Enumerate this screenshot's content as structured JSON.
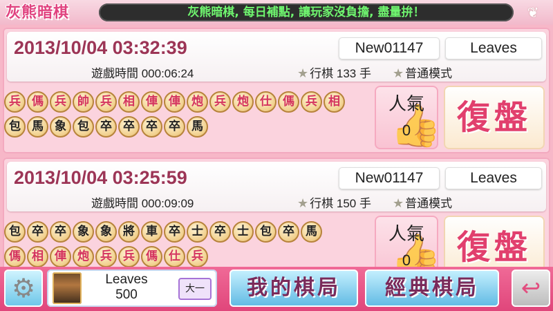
{
  "header": {
    "logo_text": "灰熊暗棋",
    "marquee_text": "灰熊暗棋, 每日補點, 讓玩家沒負擔, 盡量拚！",
    "wings_icon": "wings-icon"
  },
  "games": [
    {
      "datetime": "2013/10/04 03:32:39",
      "duration": "遊戲時間 000:06:24",
      "player1": "New01147",
      "player2": "Leaves",
      "moves": "行棋 133 手",
      "mode": "普通模式",
      "popularity_label": "人氣",
      "popularity_count": "0",
      "replay_label": "復盤",
      "pieces_row1": [
        {
          "t": "兵",
          "c": "red"
        },
        {
          "t": "傌",
          "c": "red"
        },
        {
          "t": "兵",
          "c": "red"
        },
        {
          "t": "帥",
          "c": "red"
        },
        {
          "t": "兵",
          "c": "red"
        },
        {
          "t": "相",
          "c": "red"
        },
        {
          "t": "俥",
          "c": "red"
        },
        {
          "t": "俥",
          "c": "red"
        },
        {
          "t": "炮",
          "c": "red"
        },
        {
          "t": "兵",
          "c": "red"
        },
        {
          "t": "炮",
          "c": "red"
        },
        {
          "t": "仕",
          "c": "red"
        },
        {
          "t": "傌",
          "c": "red"
        },
        {
          "t": "兵",
          "c": "red"
        },
        {
          "t": "相",
          "c": "red"
        }
      ],
      "pieces_row2": [
        {
          "t": "包",
          "c": "black"
        },
        {
          "t": "馬",
          "c": "black"
        },
        {
          "t": "象",
          "c": "black"
        },
        {
          "t": "包",
          "c": "black"
        },
        {
          "t": "卒",
          "c": "black"
        },
        {
          "t": "卒",
          "c": "black"
        },
        {
          "t": "卒",
          "c": "black"
        },
        {
          "t": "卒",
          "c": "black"
        },
        {
          "t": "馬",
          "c": "black"
        }
      ]
    },
    {
      "datetime": "2013/10/04 03:25:59",
      "duration": "遊戲時間 000:09:09",
      "player1": "New01147",
      "player2": "Leaves",
      "moves": "行棋 150 手",
      "mode": "普通模式",
      "popularity_label": "人氣",
      "popularity_count": "0",
      "replay_label": "復盤",
      "pieces_row1": [
        {
          "t": "包",
          "c": "black"
        },
        {
          "t": "卒",
          "c": "black"
        },
        {
          "t": "卒",
          "c": "black"
        },
        {
          "t": "象",
          "c": "black"
        },
        {
          "t": "象",
          "c": "black"
        },
        {
          "t": "將",
          "c": "black"
        },
        {
          "t": "車",
          "c": "black"
        },
        {
          "t": "卒",
          "c": "black"
        },
        {
          "t": "士",
          "c": "black"
        },
        {
          "t": "卒",
          "c": "black"
        },
        {
          "t": "士",
          "c": "black"
        },
        {
          "t": "包",
          "c": "black"
        },
        {
          "t": "卒",
          "c": "black"
        },
        {
          "t": "馬",
          "c": "black"
        }
      ],
      "pieces_row2": [
        {
          "t": "傌",
          "c": "red"
        },
        {
          "t": "相",
          "c": "red"
        },
        {
          "t": "俥",
          "c": "red"
        },
        {
          "t": "炮",
          "c": "red"
        },
        {
          "t": "兵",
          "c": "red"
        },
        {
          "t": "兵",
          "c": "red"
        },
        {
          "t": "傌",
          "c": "red"
        },
        {
          "t": "仕",
          "c": "red"
        },
        {
          "t": "兵",
          "c": "red"
        }
      ]
    }
  ],
  "footer": {
    "settings_icon": "gear-icon",
    "profile_name": "Leaves",
    "profile_score": "500",
    "rank_badge": "大一",
    "my_games_label": "我的棋局",
    "classic_games_label": "經典棋局",
    "back_icon": "back-arrow-icon"
  }
}
